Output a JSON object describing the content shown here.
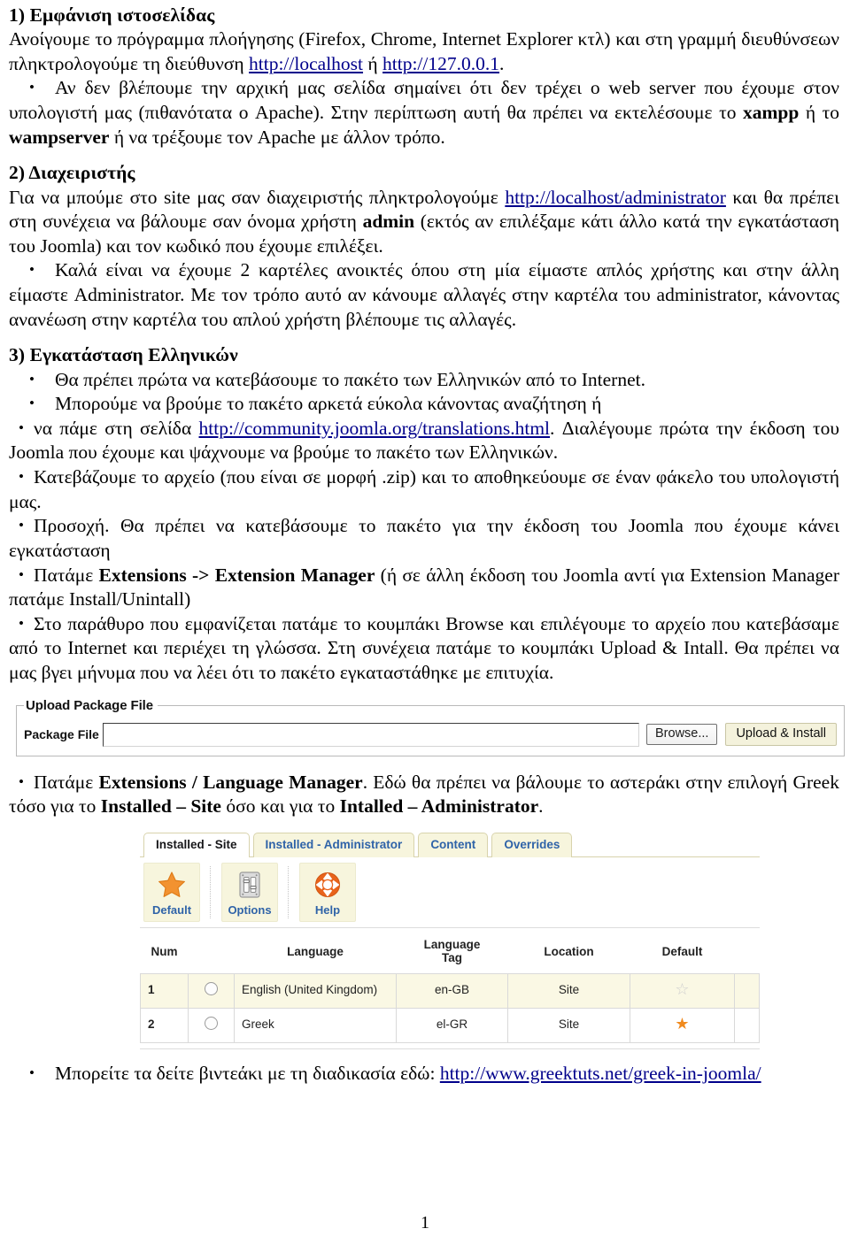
{
  "document": {
    "page_number": "1"
  },
  "section1": {
    "heading": "1) Εμφάνιση ιστοσελίδας",
    "para_a": "Ανοίγουμε το πρόγραμμα πλοήγησης (Firefox, Chrome, Internet Explorer κτλ) και στη γραμμή διευθύνσεων πληκτρολογούμε τη διεύθυνση ",
    "link_localhost": "http://localhost",
    "para_b": " ή ",
    "link_ip": "http://127.0.0.1",
    "para_c": ".",
    "bullet1_a": "Αν δεν βλέπουμε την αρχική μας σελίδα σημαίνει ότι δεν τρέχει ο web server που έχουμε στον υπολογιστή μας (πιθανότατα ο Apache). Στην περίπτωση αυτή θα πρέπει να εκτελέσουμε το ",
    "bullet1_bold1": "xampp",
    "bullet1_b": " ή το ",
    "bullet1_bold2": "wampserver",
    "bullet1_c": " ή να τρέξουμε τον Apache με άλλον τρόπο."
  },
  "section2": {
    "heading": "2) Διαχειριστής",
    "para_a": "Για να μπούμε στο site μας σαν διαχειριστής πληκτρολογούμε ",
    "link_admin": "http://localhost/administrator",
    "para_b": " και θα πρέπει στη συνέχεια να βάλουμε σαν όνομα χρήστη ",
    "bold_admin": "admin",
    "para_c": " (εκτός αν επιλέξαμε κάτι άλλο κατά την εγκατάσταση του Joomla) και τον κωδικό που έχουμε επιλέξει.",
    "bullet1": "Καλά είναι να έχουμε 2 καρτέλες ανοικτές όπου στη μία είμαστε απλός χρήστης και στην άλλη είμαστε Administrator. Με τον τρόπο αυτό αν κάνουμε αλλαγές στην καρτέλα του administrator, κάνοντας ανανέωση στην καρτέλα του απλού χρήστη βλέπουμε τις αλλαγές."
  },
  "section3": {
    "heading": "3) Εγκατάσταση Ελληνικών",
    "bullet1": "Θα πρέπει πρώτα να κατεβάσουμε το πακέτο των Ελληνικών από το Internet.",
    "bullet2": "Μπορούμε να βρούμε το πακέτο αρκετά εύκολα κάνοντας αναζήτηση ή",
    "bullet3_a": "να πάμε στη σελίδα ",
    "bullet3_link": "http://community.joomla.org/translations.html",
    "bullet3_b": ". Διαλέγουμε πρώτα την έκδοση του Joomla που έχουμε και ψάχνουμε να βρούμε το πακέτο των Ελληνικών.",
    "bullet4": "Κατεβάζουμε το αρχείο (που είναι σε μορφή .zip) και το αποθηκεύουμε σε έναν φάκελο του υπολογιστή μας.",
    "bullet5": "Προσοχή. Θα πρέπει να κατεβάσουμε το πακέτο για την έκδοση του Joomla που έχουμε κάνει εγκατάσταση",
    "bullet6_a": "Πατάμε ",
    "bullet6_bold1": "Extensions",
    "bullet6_mid": " -> ",
    "bullet6_bold2": "Extension Manager",
    "bullet6_b": " (ή σε άλλη έκδοση του Joomla αντί για Extension Manager πατάμε Install/Unintall)",
    "bullet7": "Στο παράθυρο που εμφανίζεται πατάμε το κουμπάκι Browse και επιλέγουμε το αρχείο που κατεβάσαμε από το Internet και περιέχει τη γλώσσα. Στη συνέχεια πατάμε το κουμπάκι Upload & Intall. Θα πρέπει να μας βγει μήνυμα που να λέει ότι το πακέτο εγκαταστάθηκε με επιτυχία."
  },
  "upload_screenshot": {
    "legend": "Upload Package File",
    "field_label": "Package File",
    "field_value": "",
    "browse_button": "Browse...",
    "upload_button": "Upload & Install"
  },
  "section4": {
    "bullet_a": "Πατάμε ",
    "bold1": "Extensions / Language Manager",
    "bullet_b": ". Εδώ θα πρέπει να βάλουμε το αστεράκι στην επιλογή Greek τόσο για το ",
    "bold2": "Installed – Site",
    "bullet_c": " όσο και για το ",
    "bold3": "Intalled – Administrator",
    "bullet_d": "."
  },
  "langmgr_screenshot": {
    "tabs": [
      {
        "label": "Installed - Site",
        "active": true
      },
      {
        "label": "Installed - Administrator",
        "active": false
      },
      {
        "label": "Content",
        "active": false
      },
      {
        "label": "Overrides",
        "active": false
      }
    ],
    "toolbar": [
      {
        "label": "Default",
        "icon": "star-icon"
      },
      {
        "label": "Options",
        "icon": "sliders-icon"
      },
      {
        "label": "Help",
        "icon": "lifering-icon"
      }
    ],
    "table": {
      "headers": [
        "Num",
        "",
        "Language",
        "Language Tag",
        "Location",
        "Default",
        ""
      ],
      "header_tag_line1": "Language",
      "header_tag_line2": "Tag",
      "rows": [
        {
          "num": "1",
          "language": "English (United Kingdom)",
          "tag": "en-GB",
          "location": "Site",
          "default": "empty-star"
        },
        {
          "num": "2",
          "language": "Greek",
          "tag": "el-GR",
          "location": "Site",
          "default": "filled-star"
        }
      ]
    },
    "colors": {
      "tab_active_bg": "#ffffff",
      "tab_bg": "#f7f5dd",
      "tab_text": "#2f63a8",
      "row_odd_bg": "#faf8e4",
      "star_filled": "#f08a1e",
      "star_empty": "#cfcfcf"
    }
  },
  "section5": {
    "bullet_a": "Μπορείτε τα δείτε  βιντεάκι με τη διαδικασία εδώ: ",
    "link": "http://www.greektuts.net/greek-in-joomla/"
  }
}
